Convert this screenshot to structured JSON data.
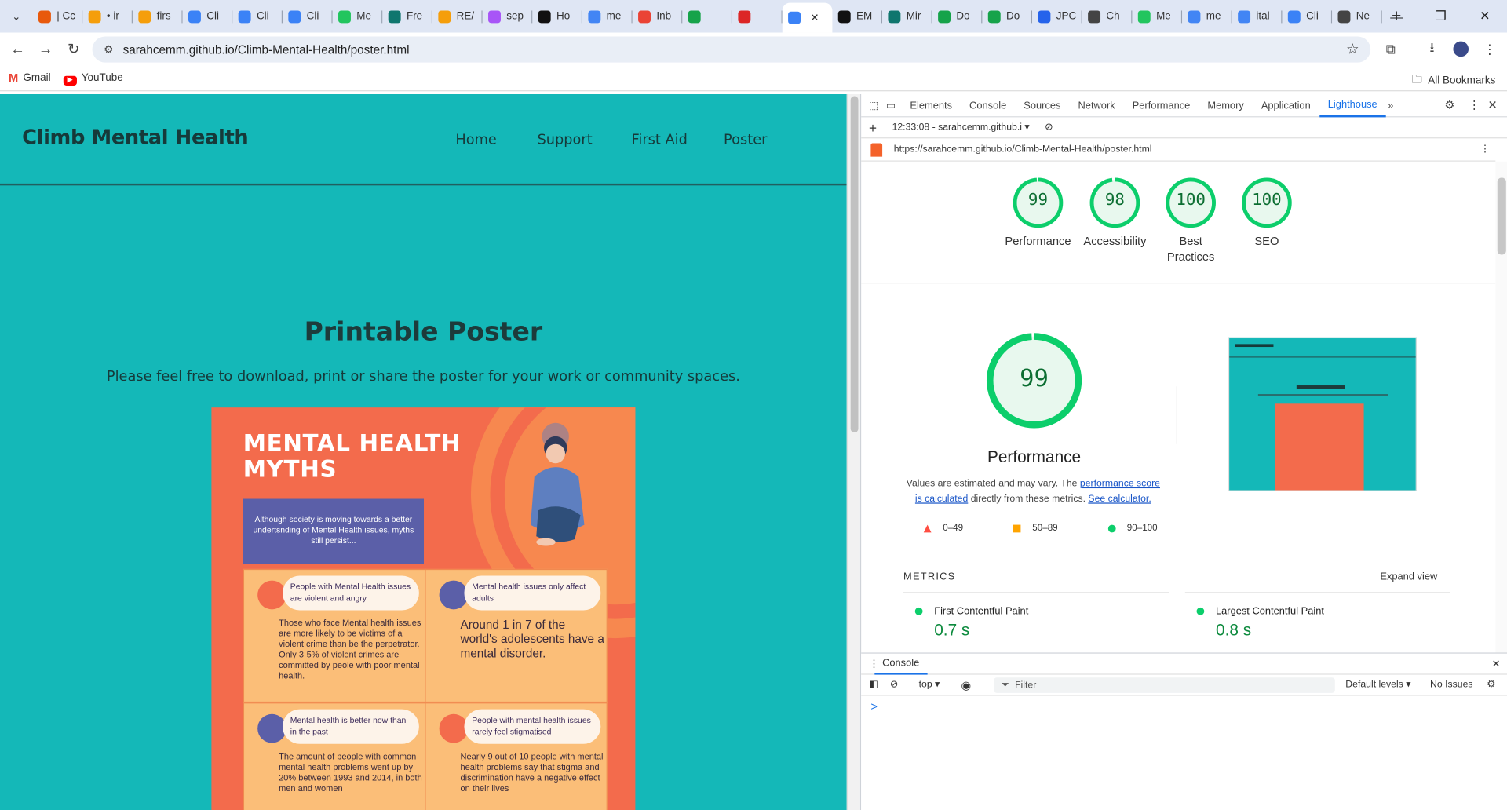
{
  "browser": {
    "tabs": [
      {
        "label": "| Cc",
        "icon": "circle-icon",
        "color": "#e8590c"
      },
      {
        "label": "• ir",
        "icon": "g-icon",
        "color": "#f59e0b"
      },
      {
        "label": "firs",
        "icon": "g-icon",
        "color": "#f59e0b"
      },
      {
        "label": "Cli",
        "icon": "climber-icon",
        "color": "#3b82f6"
      },
      {
        "label": "Cli",
        "icon": "climber-icon",
        "color": "#3b82f6"
      },
      {
        "label": "Cli",
        "icon": "climber-icon",
        "color": "#3b82f6"
      },
      {
        "label": "Me",
        "icon": "leaf-icon",
        "color": "#22c55e"
      },
      {
        "label": "Fre",
        "icon": "leaf-icon",
        "color": "#0f766e"
      },
      {
        "label": "RE/",
        "icon": "g-icon",
        "color": "#f59e0b"
      },
      {
        "label": "sep",
        "icon": "slack-icon",
        "color": "#a855f7"
      },
      {
        "label": "Ho",
        "icon": "ai-icon",
        "color": "#111111"
      },
      {
        "label": "me",
        "icon": "google-icon",
        "color": "#4285f4"
      },
      {
        "label": "Inb",
        "icon": "gmail-icon",
        "color": "#ea4335"
      },
      {
        "label": "",
        "icon": "meet-icon",
        "color": "#16a34a"
      },
      {
        "label": "",
        "icon": "record-icon",
        "color": "#dc2626"
      },
      {
        "label": "",
        "icon": "climber-icon",
        "color": "#3b82f6",
        "active": true
      },
      {
        "label": "EM",
        "icon": "ai-icon",
        "color": "#111111"
      },
      {
        "label": "Mir",
        "icon": "leaf-icon",
        "color": "#0f766e"
      },
      {
        "label": "Do",
        "icon": "px-icon",
        "color": "#16a34a"
      },
      {
        "label": "Do",
        "icon": "px-icon",
        "color": "#16a34a"
      },
      {
        "label": "JPC",
        "icon": "jp-icon",
        "color": "#2563eb"
      },
      {
        "label": "Ch",
        "icon": "chatgpt-icon",
        "color": "#444444"
      },
      {
        "label": "Me",
        "icon": "leaf-icon",
        "color": "#22c55e"
      },
      {
        "label": "me",
        "icon": "google-icon",
        "color": "#4285f4"
      },
      {
        "label": "ital",
        "icon": "google-icon",
        "color": "#4285f4"
      },
      {
        "label": "Cli",
        "icon": "climber-icon",
        "color": "#3b82f6"
      },
      {
        "label": "Ne",
        "icon": "chatgpt-icon",
        "color": "#444444"
      }
    ],
    "url": "sarahcemm.github.io/Climb-Mental-Health/poster.html",
    "bookmarks": [
      {
        "label": "Gmail",
        "icon": "gmail-icon"
      },
      {
        "label": "YouTube",
        "icon": "youtube-icon"
      }
    ],
    "all_bookmarks": "All Bookmarks"
  },
  "site": {
    "brand": "Climb Mental Health",
    "nav": [
      "Home",
      "Support",
      "First Aid",
      "Poster"
    ],
    "title": "Printable Poster",
    "subtitle": "Please feel free to download, print or share the poster for your work or community spaces.",
    "poster": {
      "heading_line1": "MENTAL HEALTH",
      "heading_line2": "MYTHS",
      "intro": "Although society is moving towards a better undertsnding of Mental Health issues, myths still persist...",
      "cells": [
        {
          "myth": "People with Mental Health issues are violent and angry",
          "fact": "Those who face Mental health issues are more likely to be victims of a violent crime than be the perpetrator. Only 3-5% of violent crimes are committed by peole with poor mental health.",
          "dot": "#f36b4c"
        },
        {
          "myth": "Mental health issues only affect adults",
          "fact": "Around 1 in 7 of the world's adolescents have a mental disorder.",
          "dot": "#5b5fa8"
        },
        {
          "myth": "Mental health is better now than in the past",
          "fact": "The amount of people with common mental health problems went up by 20% between 1993 and 2014, in both men and women",
          "dot": "#5b5fa8"
        },
        {
          "myth": "People with mental health issues rarely feel stigmatised",
          "fact": "Nearly 9 out of 10 people with mental health problems say that stigma and discrimination have a negative effect on their lives",
          "dot": "#f36b4c"
        }
      ]
    }
  },
  "devtools": {
    "tabs": [
      "Elements",
      "Console",
      "Sources",
      "Network",
      "Performance",
      "Memory",
      "Application",
      "Lighthouse"
    ],
    "active_tab": "Lighthouse",
    "report_selector": "12:33:08 - sarahcemm.github.i",
    "report_url": "https://sarahcemm.github.io/Climb-Mental-Health/poster.html",
    "scores": [
      {
        "value": "99",
        "label_line1": "Performance",
        "label_line2": "",
        "fraction": 0.99
      },
      {
        "value": "98",
        "label_line1": "Accessibility",
        "label_line2": "",
        "fraction": 0.98
      },
      {
        "value": "100",
        "label_line1": "Best",
        "label_line2": "Practices",
        "fraction": 1.0
      },
      {
        "value": "100",
        "label_line1": "SEO",
        "label_line2": "",
        "fraction": 1.0
      }
    ],
    "main_score": {
      "value": "99",
      "label": "Performance",
      "fraction": 0.99
    },
    "note_text1": "Values are estimated and may vary. The ",
    "note_link1": "performance score is calculated",
    "note_text2": " directly from these metrics. ",
    "note_link2": "See calculator.",
    "legend": [
      "0–49",
      "50–89",
      "90–100"
    ],
    "legend_colors": {
      "fail": "#ff4e42",
      "average": "#ffa400",
      "pass": "#0cce6b"
    },
    "metrics_header": "METRICS",
    "expand_view": "Expand view",
    "metrics": [
      {
        "name": "First Contentful Paint",
        "value": "0.7 s"
      },
      {
        "name": "Largest Contentful Paint",
        "value": "0.8 s"
      }
    ],
    "console": {
      "tab": "Console",
      "context": "top",
      "filter_placeholder": "Filter",
      "levels": "Default levels",
      "issues": "No Issues",
      "prompt": ">"
    }
  },
  "colors": {
    "site_bg": "#14b8b8",
    "poster_bg": "#f36b4c",
    "poster_cell": "#fbbe78",
    "poster_intro": "#5b5fa8",
    "gauge_pass": "#0cce6b",
    "link": "#1a56c8"
  }
}
